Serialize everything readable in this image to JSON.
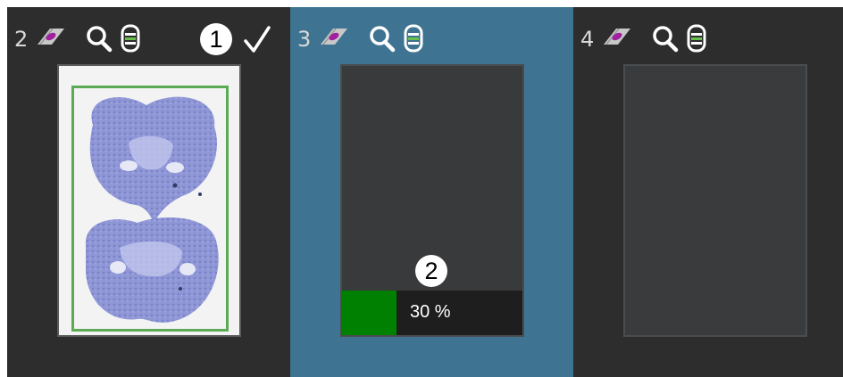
{
  "slots": [
    {
      "number": "2",
      "state": "done",
      "callout": "1"
    },
    {
      "number": "3",
      "state": "scanning",
      "callout": "2",
      "progress_label": "30 %",
      "progress_fraction": 0.3
    },
    {
      "number": "4",
      "state": "empty"
    }
  ],
  "icons": [
    "slide-icon",
    "magnifier-icon",
    "objective-icon",
    "checkmark-icon"
  ],
  "colors": {
    "panel_background": "#2d2d2d",
    "active_slot_background": "#3e7391",
    "progress_fill": "#008000",
    "roi_frame": "#5daa55",
    "tissue_stain": "#8f96d6"
  }
}
